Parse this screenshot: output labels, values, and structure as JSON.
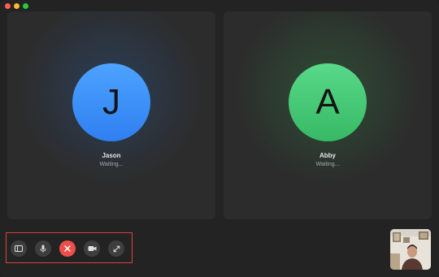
{
  "window": {
    "traffic_lights": [
      "close",
      "minimize",
      "zoom"
    ],
    "colors": {
      "close": "#fe5f57",
      "minimize": "#febc2e",
      "zoom": "#28c840"
    }
  },
  "participants": [
    {
      "initial": "J",
      "name": "Jason",
      "status": "Waiting...",
      "color": "#3a8ef7"
    },
    {
      "initial": "A",
      "name": "Abby",
      "status": "Waiting...",
      "color": "#45c774"
    }
  ],
  "controls": [
    {
      "name": "sidebar-toggle",
      "icon": "sidebar-icon"
    },
    {
      "name": "mute",
      "icon": "microphone-icon"
    },
    {
      "name": "end-call",
      "icon": "close-icon",
      "color": "#ee4f4a"
    },
    {
      "name": "video",
      "icon": "video-camera-icon"
    },
    {
      "name": "fullscreen",
      "icon": "expand-icon"
    }
  ],
  "self_view": {
    "icon": "self-camera-preview"
  }
}
